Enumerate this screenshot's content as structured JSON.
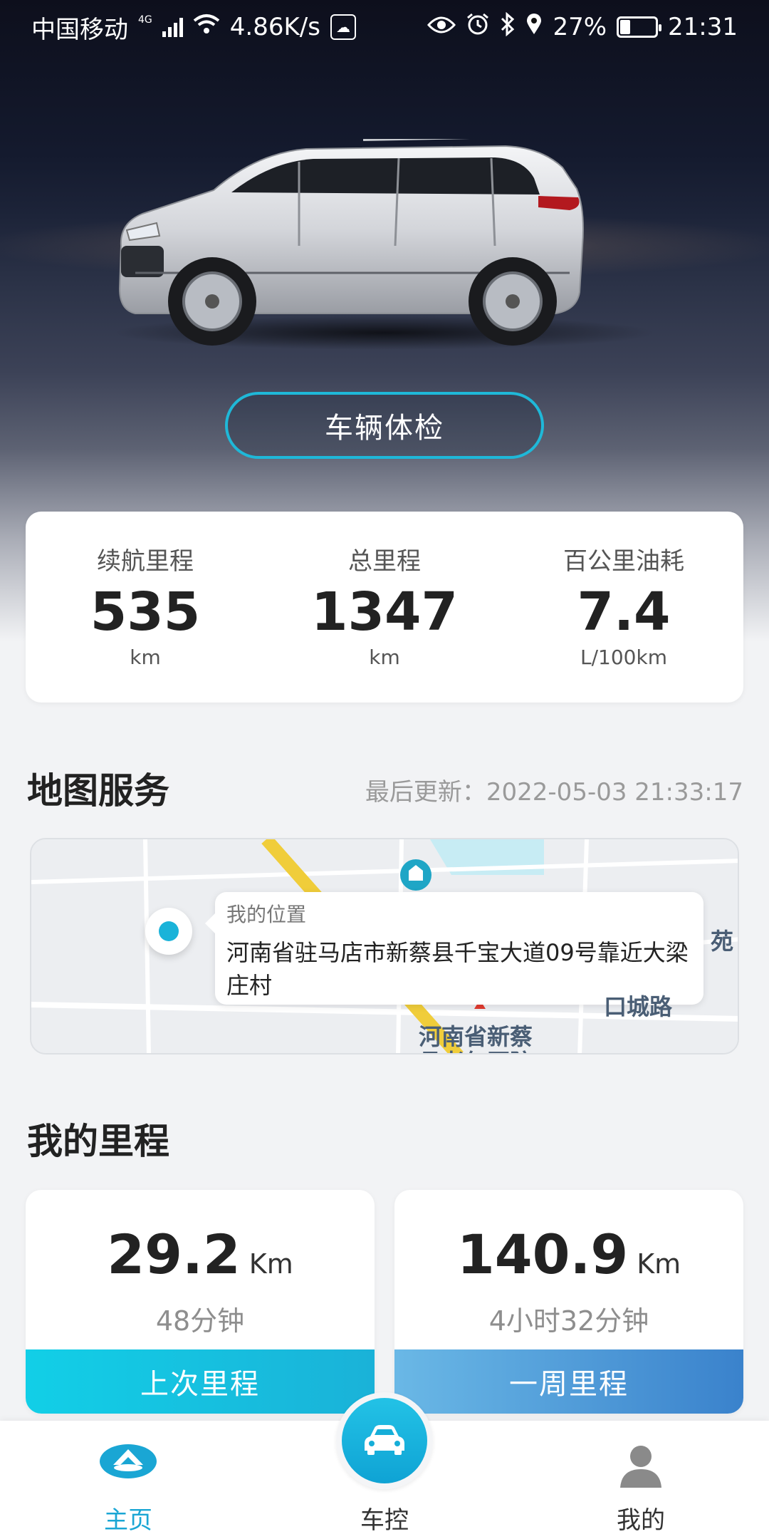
{
  "status_bar": {
    "carrier": "中国移动",
    "network_type": "4G",
    "speed": "4.86K/s",
    "battery": "27%",
    "battery_level": 0.27,
    "time": "21:31"
  },
  "hero": {
    "check_button": "车辆体检"
  },
  "stats": [
    {
      "label": "续航里程",
      "value": "535",
      "unit": "km"
    },
    {
      "label": "总里程",
      "value": "1347",
      "unit": "km"
    },
    {
      "label": "百公里油耗",
      "value": "7.4",
      "unit": "L/100km"
    }
  ],
  "map_section": {
    "title": "地图服务",
    "update_label": "最后更新：",
    "update_time": "2022-05-03 21:33:17",
    "popup_title": "我的位置",
    "popup_address": "河南省驻马店市新蔡县千宝大道09号靠近大梁庄村",
    "labels": [
      "河南省新蔡",
      "县老年医院",
      "苑",
      "口城路"
    ]
  },
  "mileage_section": {
    "title": "我的里程",
    "last": {
      "value": "29.2",
      "unit": "Km",
      "duration": "48分钟",
      "label": "上次里程"
    },
    "week": {
      "value": "140.9",
      "unit": "Km",
      "duration": "4小时32分钟",
      "label": "一周里程"
    }
  },
  "bottom_nav": {
    "home": "主页",
    "control": "车控",
    "mine": "我的"
  },
  "colors": {
    "accent": "#1ab3d9",
    "nav_active": "#1aa6d4",
    "week_blue": "#3a82cc"
  }
}
